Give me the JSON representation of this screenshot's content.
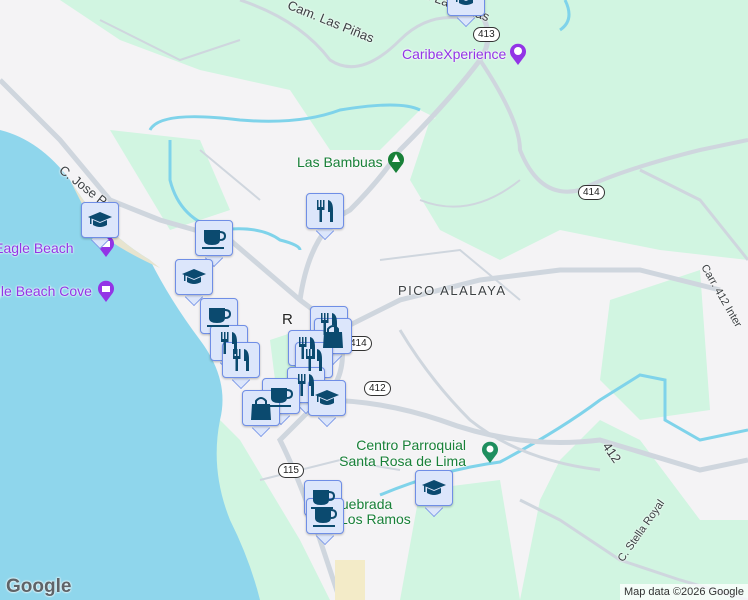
{
  "map": {
    "labels": {
      "road_las_pinas": "Cam. Las Piñas",
      "road_las_pinas_2": "Cam. Las Piñas",
      "road_jose": "C. Jose P",
      "road_carr412": "Carr. 412 Inter",
      "road_412": "412",
      "road_stella": "C. Stella Royal",
      "district": "PICO ALALAYA",
      "town_partial": "R",
      "quebrada_1": "Quebrada",
      "quebrada_2": "Los Ramos"
    },
    "pois": {
      "caribe": "CaribeXperience",
      "bambuas": "Las Bambuas",
      "black_eagle": "Black Eagle Beach",
      "eagle_cove": "Eagle Beach Cove",
      "centro_1": "Centro Parroquial",
      "centro_2": "Santa Rosa de Lima"
    },
    "shields": [
      "413",
      "414",
      "414",
      "412",
      "115"
    ],
    "markers": [
      "school-icon",
      "coffee-icon",
      "fork-knife-icon",
      "shopping-bag-icon"
    ],
    "colors": {
      "water": "#8fd6ec",
      "park": "#d1f5e1",
      "land": "#f4f3f5",
      "road": "#cfd6de",
      "river": "#7fd3ea",
      "marker_fill": "#dce6fb",
      "marker_border": "#6f8ee6",
      "marker_icon": "#0b4a6f"
    },
    "attribution": "Map data ©2026 Google",
    "logo": "Google"
  }
}
